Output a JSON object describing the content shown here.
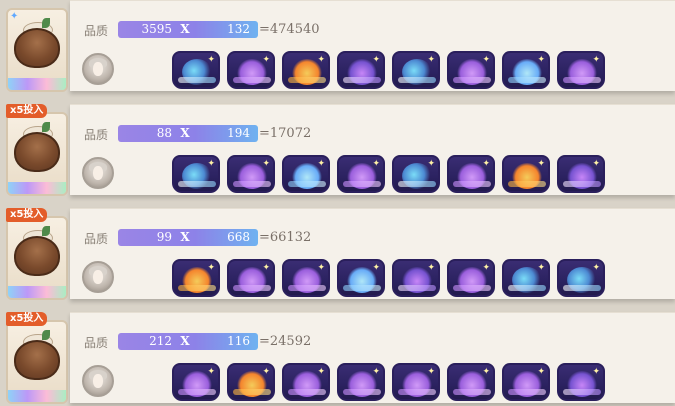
{
  "rows": [
    {
      "tag": "",
      "quality_label": "品质",
      "a": "3595",
      "x": "X",
      "b": "132",
      "result": "=474540",
      "items": [
        "orb-icon",
        "potion-icon",
        "flame-icon",
        "book-icon",
        "orb-icon",
        "potion-icon",
        "crystal-icon",
        "potion-icon"
      ]
    },
    {
      "tag": "x5投入",
      "quality_label": "品质",
      "a": "88",
      "x": "X",
      "b": "194",
      "result": "=17072",
      "items": [
        "orb-icon",
        "potion-icon",
        "crystal-icon",
        "potion-icon",
        "orb-icon",
        "potion-icon",
        "flame-icon",
        "book-icon"
      ]
    },
    {
      "tag": "x5投入",
      "quality_label": "品质",
      "a": "99",
      "x": "X",
      "b": "668",
      "result": "=66132",
      "items": [
        "flame-icon",
        "potion-icon",
        "potion-icon",
        "crystal-icon",
        "book-icon",
        "potion-icon",
        "orb-icon",
        "orb-icon"
      ]
    },
    {
      "tag": "x5投入",
      "quality_label": "品质",
      "a": "212",
      "x": "X",
      "b": "116",
      "result": "=24592",
      "items": [
        "potion-icon",
        "flame-icon",
        "potion-icon",
        "potion-icon",
        "potion-icon",
        "potion-icon",
        "potion-icon",
        "book-icon"
      ]
    }
  ],
  "colors": {
    "background": "#d9d3c8",
    "card": "#f5f1ea",
    "tag": "#e35d2a",
    "formula_start": "#9a85e6",
    "formula_end": "#6fb2f0"
  }
}
